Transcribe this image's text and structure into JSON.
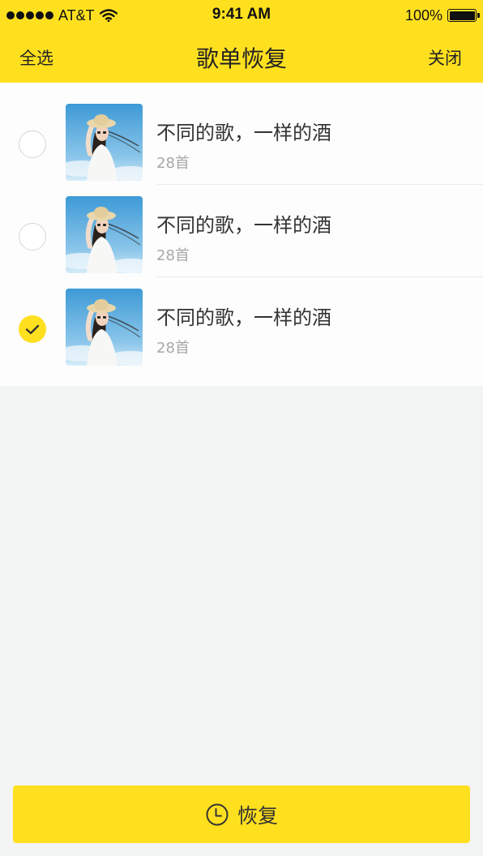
{
  "status_bar": {
    "carrier": "AT&T",
    "time": "9:41 AM",
    "battery": "100%"
  },
  "nav": {
    "select_all": "全选",
    "title": "歌单恢复",
    "close": "关闭"
  },
  "playlists": [
    {
      "title": "不同的歌，一样的酒",
      "count": "28首",
      "selected": false
    },
    {
      "title": "不同的歌，一样的酒",
      "count": "28首",
      "selected": false
    },
    {
      "title": "不同的歌，一样的酒",
      "count": "28首",
      "selected": true
    }
  ],
  "footer": {
    "restore_label": "恢复"
  },
  "colors": {
    "accent": "#ffe01f",
    "background": "#f3f5f4",
    "text_primary": "#333333",
    "text_secondary": "#a8a8a8"
  },
  "icons": {
    "signal": "signal-dots-icon",
    "wifi": "wifi-icon",
    "battery": "battery-icon",
    "check": "check-icon",
    "restore": "clock-icon"
  }
}
